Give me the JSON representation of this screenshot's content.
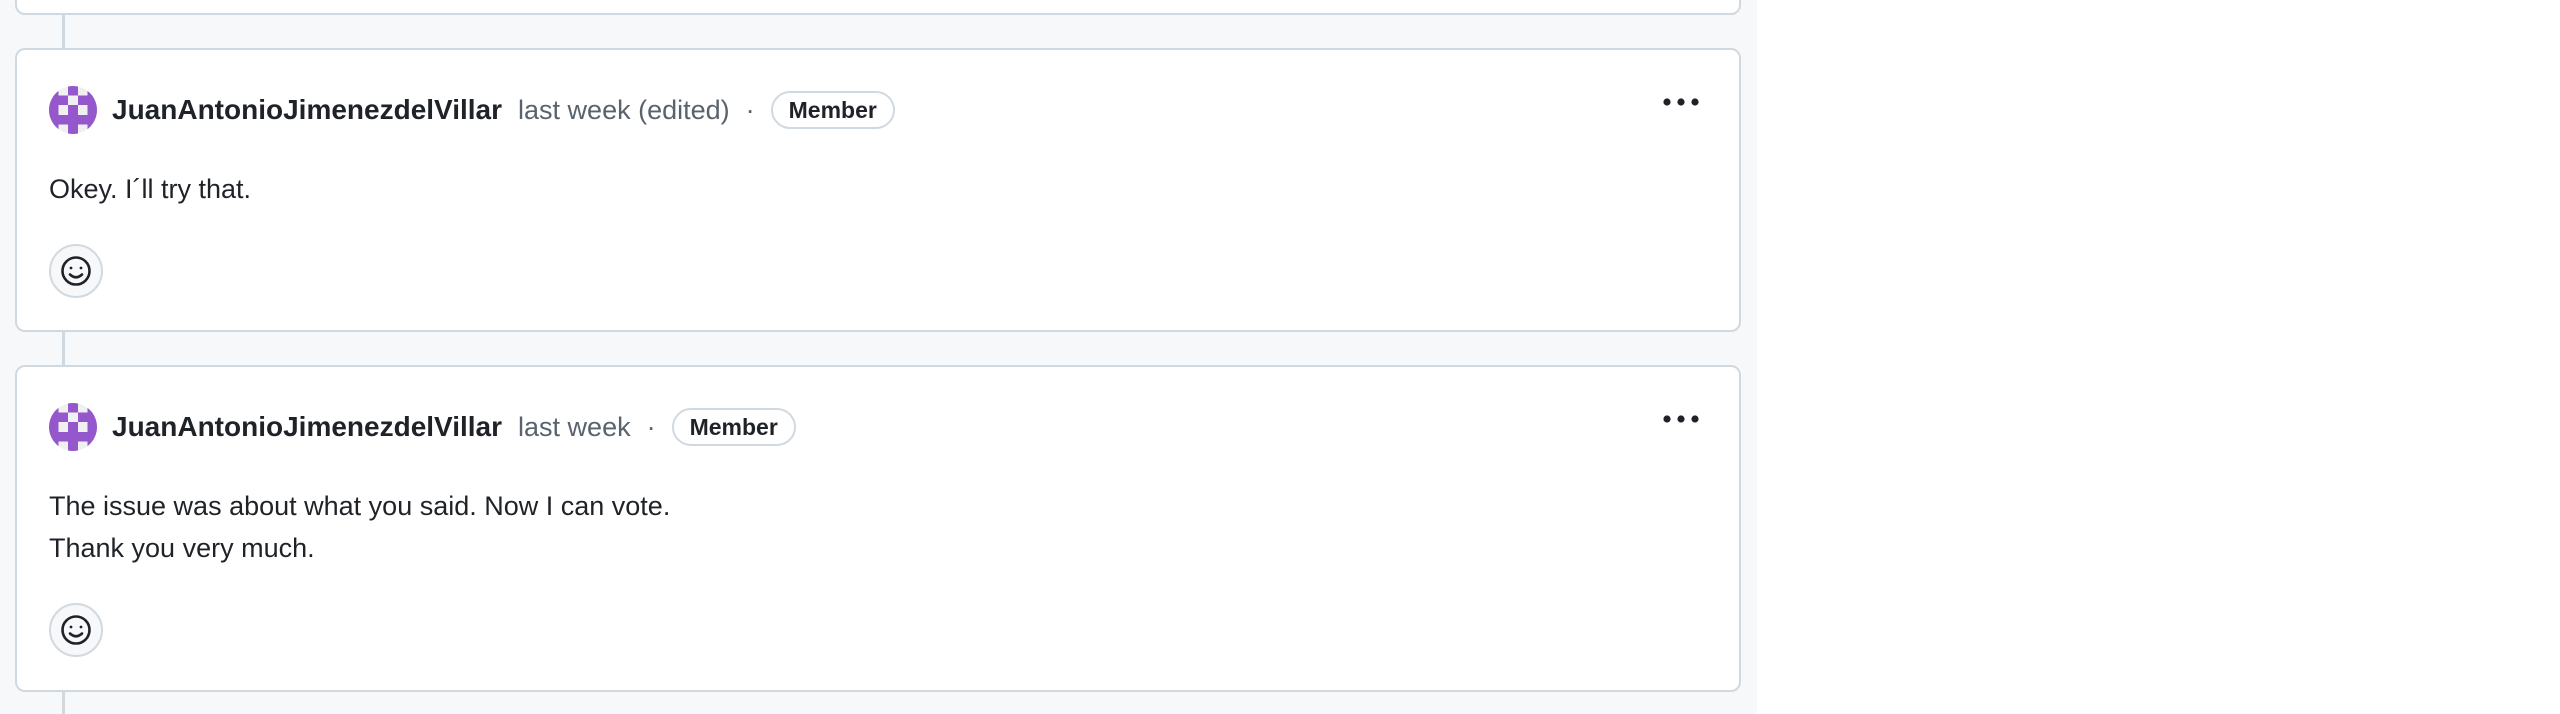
{
  "comments": [
    {
      "author": "JuanAntonioJimenezdelVillar",
      "timestamp": "last week (edited)",
      "separator": "·",
      "role_badge": "Member",
      "body": [
        "Okey. I´ll try that."
      ]
    },
    {
      "author": "JuanAntonioJimenezdelVillar",
      "timestamp": "last week",
      "separator": "·",
      "role_badge": "Member",
      "body": [
        "The issue was about what you said. Now I can vote.",
        "Thank you very much."
      ]
    }
  ],
  "icons": {
    "more": "kebab-horizontal-icon",
    "reaction": "smiley-icon",
    "avatar": "identicon-avatar"
  },
  "colors": {
    "page_background": "#f6f8fa",
    "card_border": "#d1d9e0",
    "text_primary": "#1f2328",
    "text_muted": "#59636e",
    "avatar_accent": "#9457cc"
  }
}
